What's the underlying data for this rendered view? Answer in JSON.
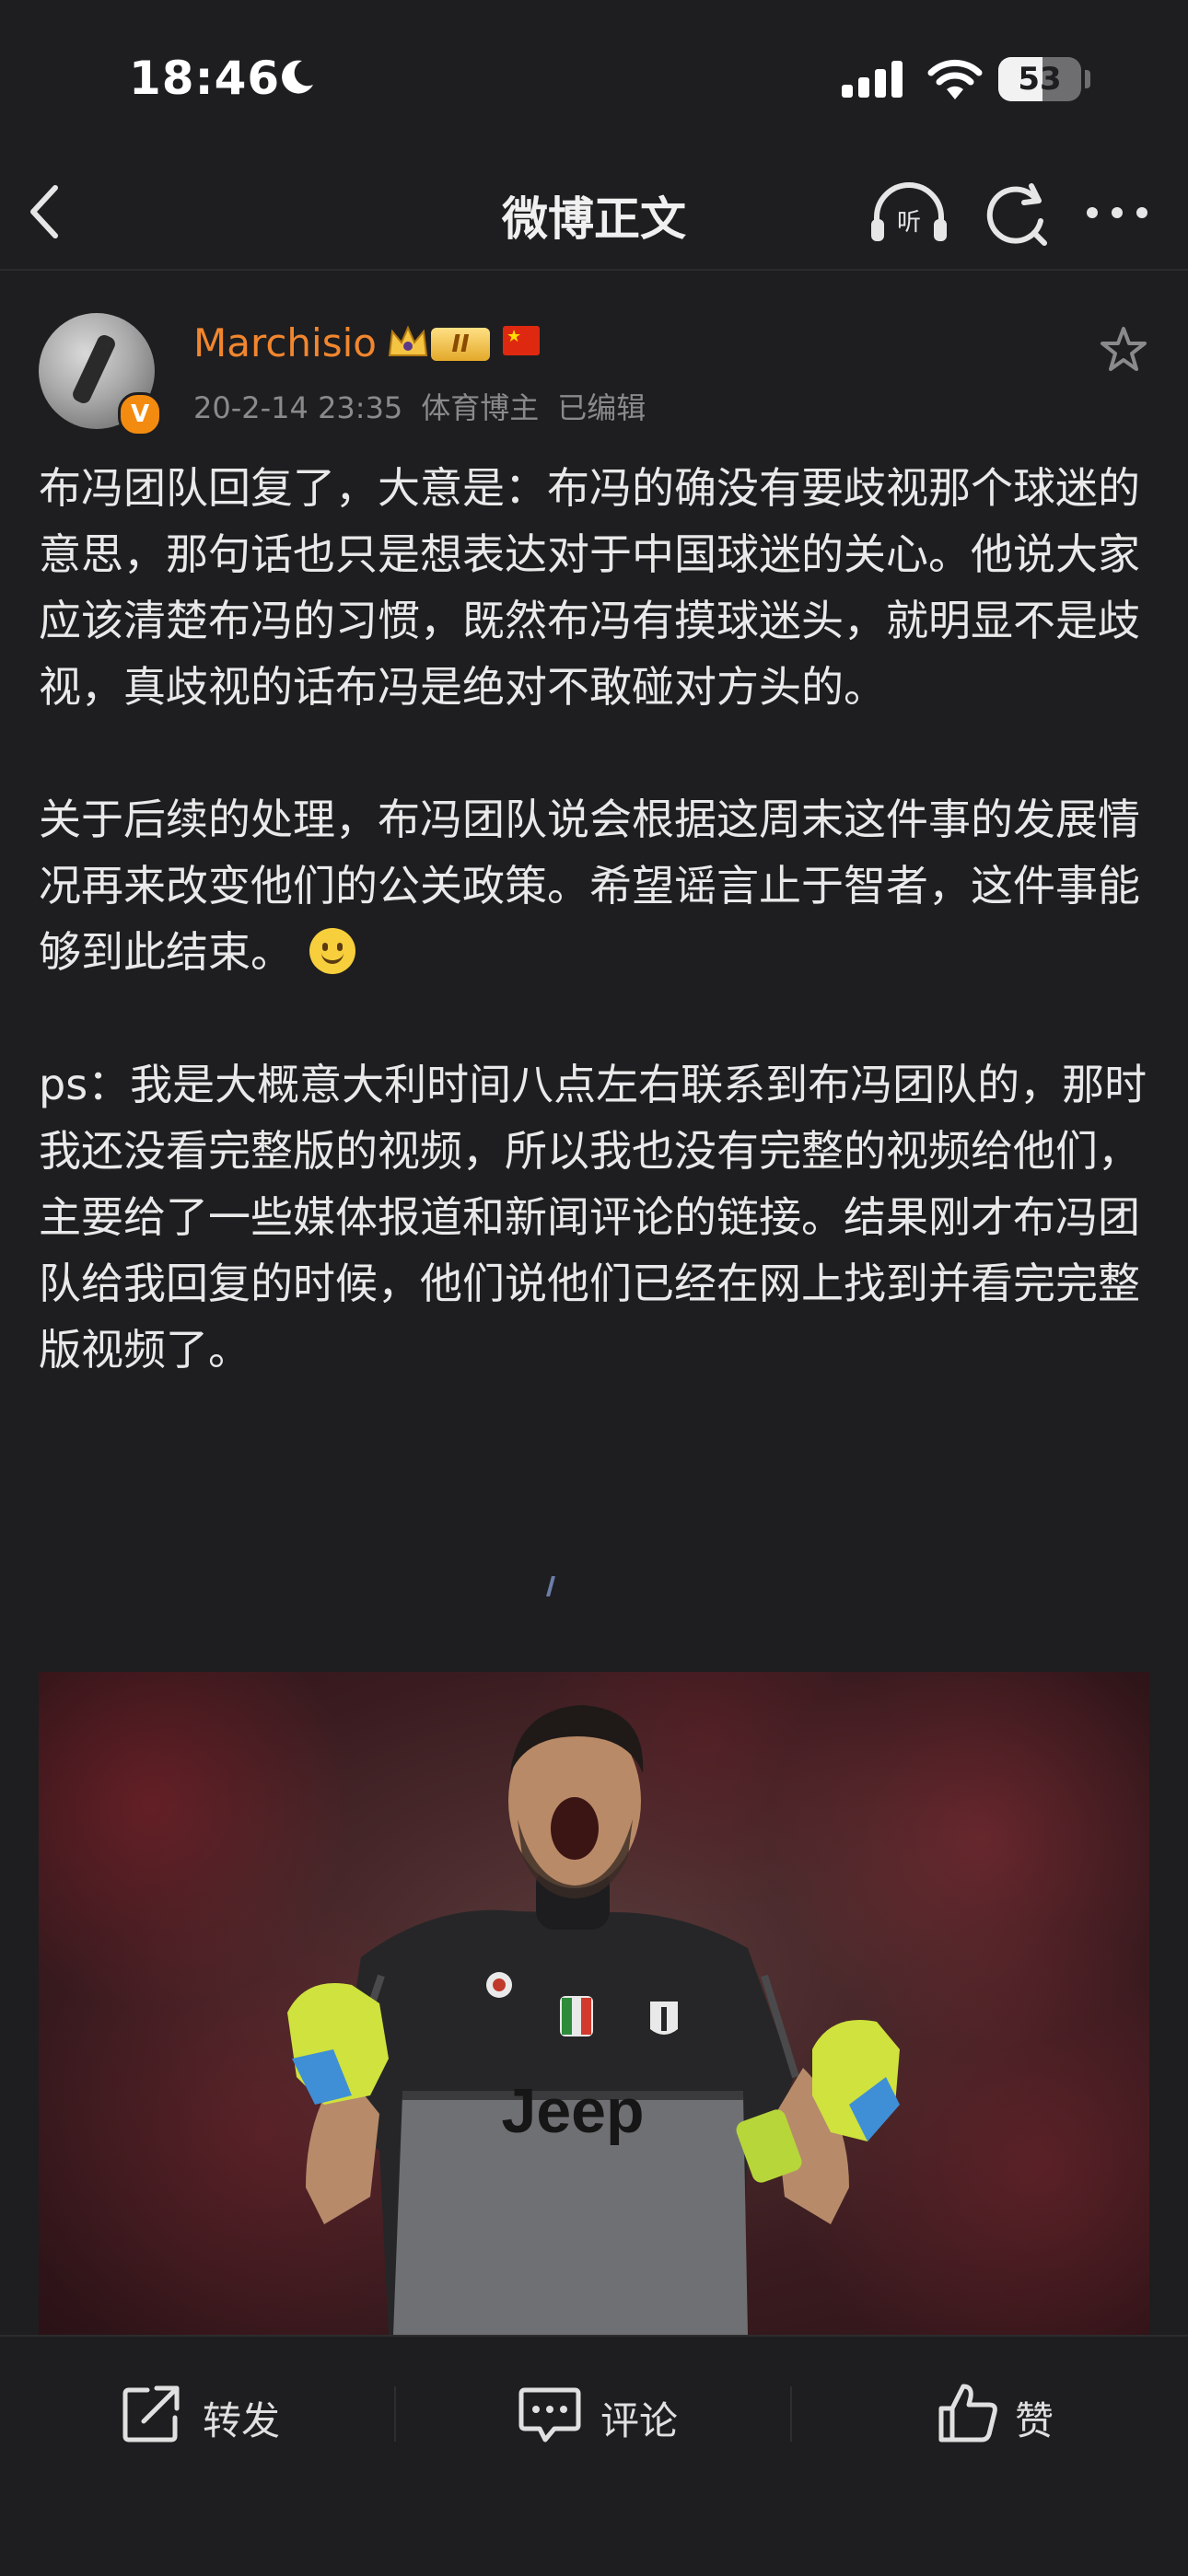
{
  "status_bar": {
    "time": "18:46",
    "battery": "53",
    "battery_level": 0.53
  },
  "nav": {
    "title": "微博正文",
    "listen_label": "听"
  },
  "author": {
    "name": "Marchisio",
    "level": "II",
    "verified_badge": "V",
    "date": "20-2-14 23:35",
    "category": "体育博主",
    "edited": "已编辑"
  },
  "post": {
    "para1": "布冯团队回复了，大意是：布冯的确没有要歧视那个球迷的意思，那句话也只是想表达对于中国球迷的关心。他说大家应该清楚布冯的习惯，既然布冯有摸球迷头，就明显不是歧视，真歧视的话布冯是绝对不敢碰对方头的。",
    "para2": "关于后续的处理，布冯团队说会根据这周末这件事的发展情况再来改变他们的公关政策。希望谣言止于智者，这件事能够到此结束。",
    "para3": "ps：我是大概意大利时间八点左右联系到布冯团队的，那时我还没看完整版的视频，所以我也没有完整的视频给他们，主要给了一些媒体报道和新闻评论的链接。结果刚才布冯团队给我回复的时候，他们说他们已经在网上找到并看完完整版视频了。"
  },
  "photo": {
    "shirt_text": "Jeep"
  },
  "actions": {
    "repost": "转发",
    "comment": "评论",
    "like": "赞"
  },
  "colors": {
    "background": "#1e1e20",
    "username": "#f2862e",
    "meta": "#8a8a8c"
  }
}
